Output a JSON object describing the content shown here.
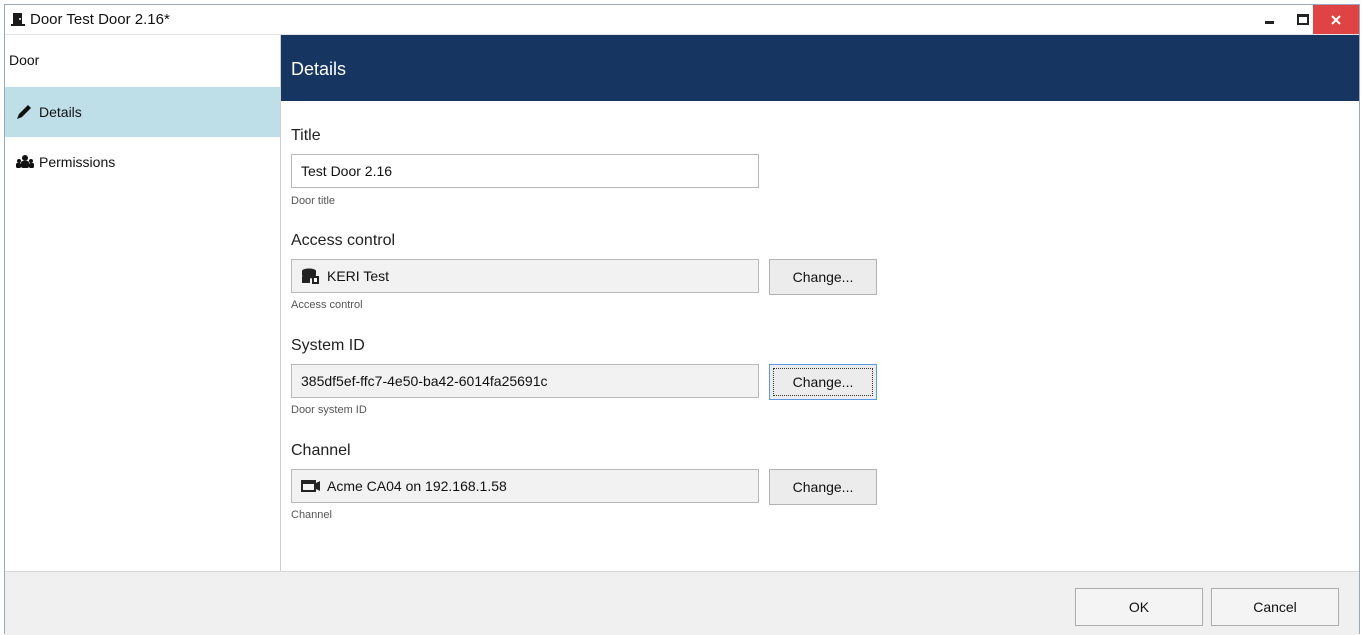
{
  "window": {
    "title": "Door Test Door 2.16*",
    "close_color": "#e04343"
  },
  "sidebar": {
    "header": "Door",
    "items": [
      {
        "label": "Details",
        "icon": "pencil-icon",
        "active": true
      },
      {
        "label": "Permissions",
        "icon": "users-icon",
        "active": false
      }
    ]
  },
  "main": {
    "header_title": "Details",
    "header_color": "#163561",
    "fields": [
      {
        "label": "Title",
        "value": "Test Door 2.16",
        "hint": "Door title",
        "icon": null,
        "readonly": false
      },
      {
        "label": "Access control",
        "value": "KERI Test",
        "hint": "Access control",
        "icon": "access-control-icon",
        "readonly": true,
        "button": "Change..."
      },
      {
        "label": "System ID",
        "value": "385df5ef-ffc7-4e50-ba42-6014fa25691c",
        "hint": "Door system ID",
        "icon": null,
        "readonly": true,
        "button": "Change..."
      },
      {
        "label": "Channel",
        "value": "Acme CA04 on 192.168.1.58",
        "hint": "Channel",
        "icon": "camera-channel-icon",
        "readonly": true,
        "button": "Change..."
      }
    ]
  },
  "footer": {
    "ok_label": "OK",
    "cancel_label": "Cancel"
  }
}
